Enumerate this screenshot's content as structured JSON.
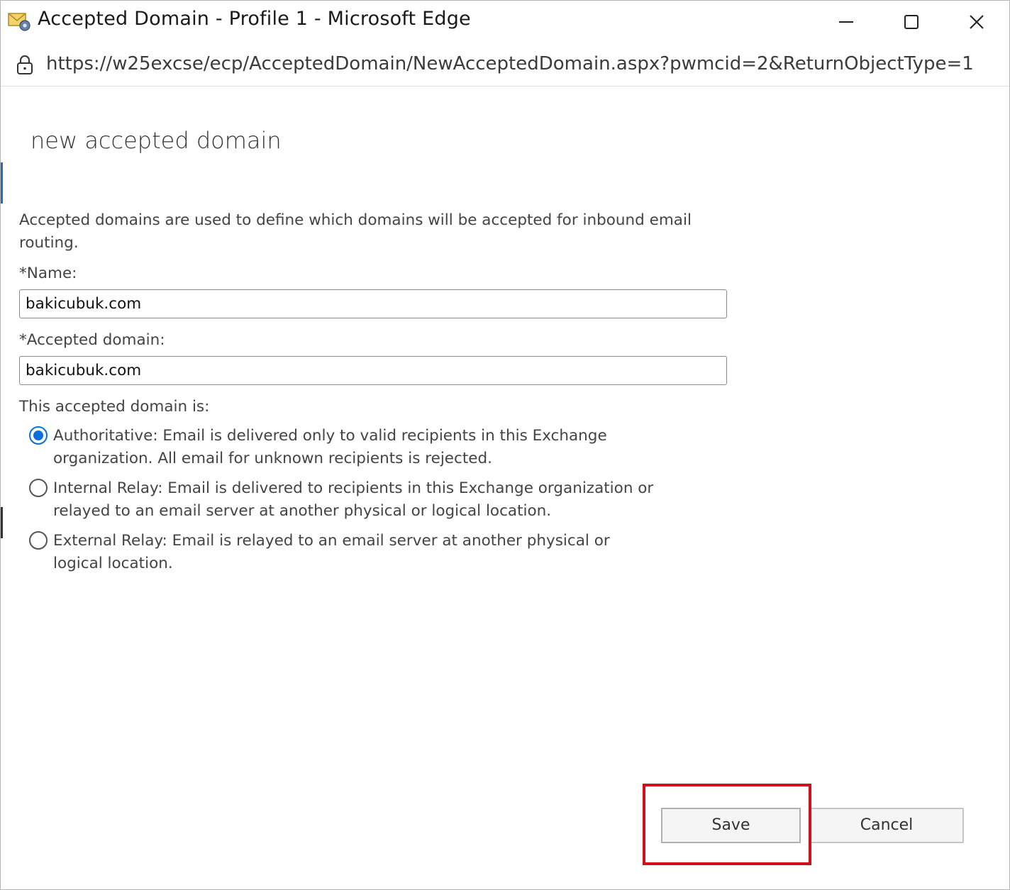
{
  "window": {
    "title": "Accepted Domain - Profile 1 - Microsoft Edge",
    "url": "https://w25excse/ecp/AcceptedDomain/NewAcceptedDomain.aspx?pwmcid=2&ReturnObjectType=1"
  },
  "dialog": {
    "title": "new accepted domain",
    "intro": "Accepted domains are used to define which domains will be accepted for inbound email routing.",
    "name_label": "*Name:",
    "name_value": "bakicubuk.com",
    "domain_label": "*Accepted domain:",
    "domain_value": "bakicubuk.com",
    "type_label": "This accepted domain is:",
    "options": [
      {
        "label": "Authoritative: Email is delivered only to valid recipients in this Exchange organization. All email for unknown recipients is rejected.",
        "selected": true
      },
      {
        "label": "Internal Relay: Email is delivered to recipients in this Exchange organization or relayed to an email server at another physical or logical location.",
        "selected": false
      },
      {
        "label": "External Relay: Email is relayed to an email server at another physical or logical location.",
        "selected": false
      }
    ]
  },
  "buttons": {
    "save": "Save",
    "cancel": "Cancel"
  },
  "colors": {
    "accent": "#0a6fe0",
    "highlight": "#d0101b"
  },
  "icons": [
    "mail-app-icon",
    "minimize-icon",
    "maximize-icon",
    "close-icon",
    "lock-icon"
  ]
}
